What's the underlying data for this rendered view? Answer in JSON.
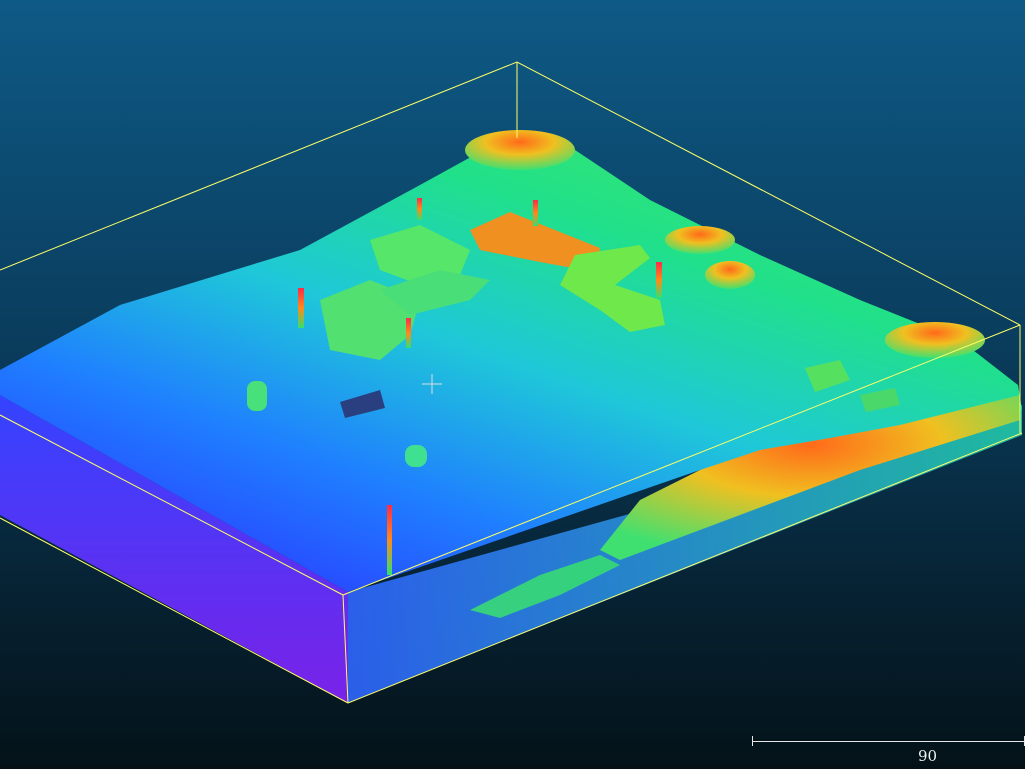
{
  "viewer": {
    "background_top": "#0e5a86",
    "background_bottom": "#041218",
    "bounding_box_color": "#ffff66",
    "colormap": [
      "#6a1fd8",
      "#2f4fff",
      "#1f8fff",
      "#1fd0d0",
      "#2ee88a",
      "#8fef2a",
      "#e8d020",
      "#ff7a1a",
      "#ff2a4a"
    ]
  },
  "scale_bar": {
    "label": "90"
  },
  "cursor": {
    "icon": "crosshair-icon"
  }
}
